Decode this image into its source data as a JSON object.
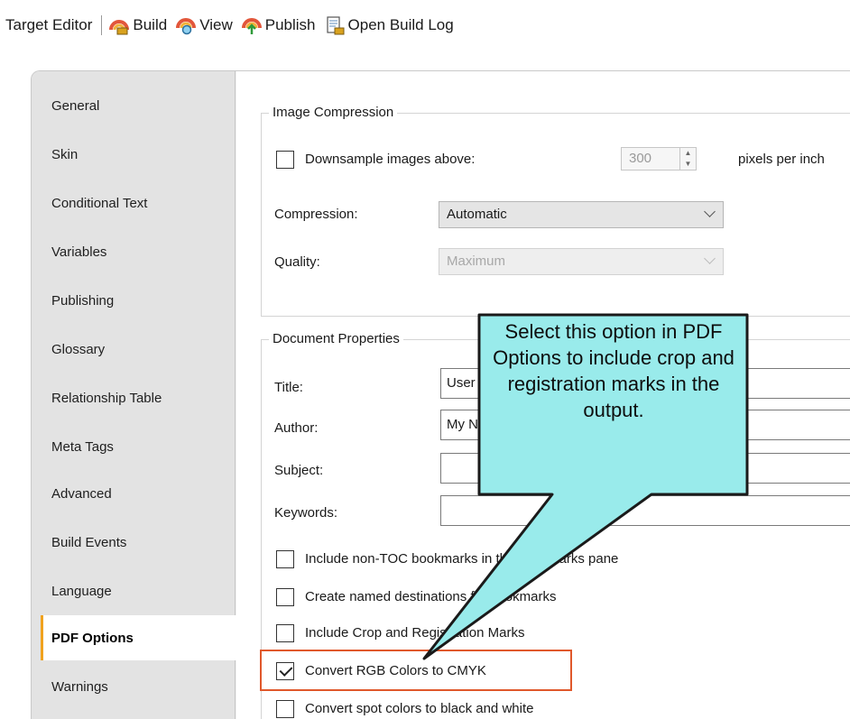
{
  "toolbar": {
    "title": "Target Editor",
    "build": "Build",
    "view": "View",
    "publish": "Publish",
    "open_build_log": "Open Build Log"
  },
  "sidebar": {
    "items": [
      {
        "label": "General"
      },
      {
        "label": "Skin"
      },
      {
        "label": "Conditional Text"
      },
      {
        "label": "Variables"
      },
      {
        "label": "Publishing"
      },
      {
        "label": "Glossary"
      },
      {
        "label": "Relationship Table"
      },
      {
        "label": "Meta Tags"
      },
      {
        "label": "Advanced"
      },
      {
        "label": "Build Events"
      },
      {
        "label": "Language"
      },
      {
        "label": "PDF Options"
      },
      {
        "label": "Warnings"
      }
    ],
    "active": "PDF Options"
  },
  "image_compression": {
    "legend": "Image Compression",
    "downsample_label": "Downsample images above:",
    "downsample_checked": false,
    "ppi_value": "300",
    "ppi_unit": "pixels per inch",
    "compression_label": "Compression:",
    "compression_value": "Automatic",
    "quality_label": "Quality:",
    "quality_value": "Maximum"
  },
  "document_properties": {
    "legend": "Document Properties",
    "title_label": "Title:",
    "title_value": "User",
    "author_label": "Author:",
    "author_value": "My N",
    "subject_label": "Subject:",
    "subject_value": "",
    "keywords_label": "Keywords:",
    "keywords_value": ""
  },
  "options": [
    {
      "label": "Include non-TOC bookmarks in the bookmarks pane",
      "checked": false
    },
    {
      "label": "Create named destinations for bookmarks",
      "checked": false
    },
    {
      "label": "Include Crop and Registration Marks",
      "checked": false
    },
    {
      "label": "Convert RGB Colors to CMYK",
      "checked": true
    },
    {
      "label": "Convert spot colors to black and white",
      "checked": false
    }
  ],
  "callout": {
    "text": "Select this option in PDF Options to include crop and registration marks in the output.",
    "fill": "#99ebeb",
    "outline": "#1a1a1a"
  },
  "colors": {
    "active_tab_accent": "#f0a21e",
    "highlight_border": "#e0582b"
  }
}
